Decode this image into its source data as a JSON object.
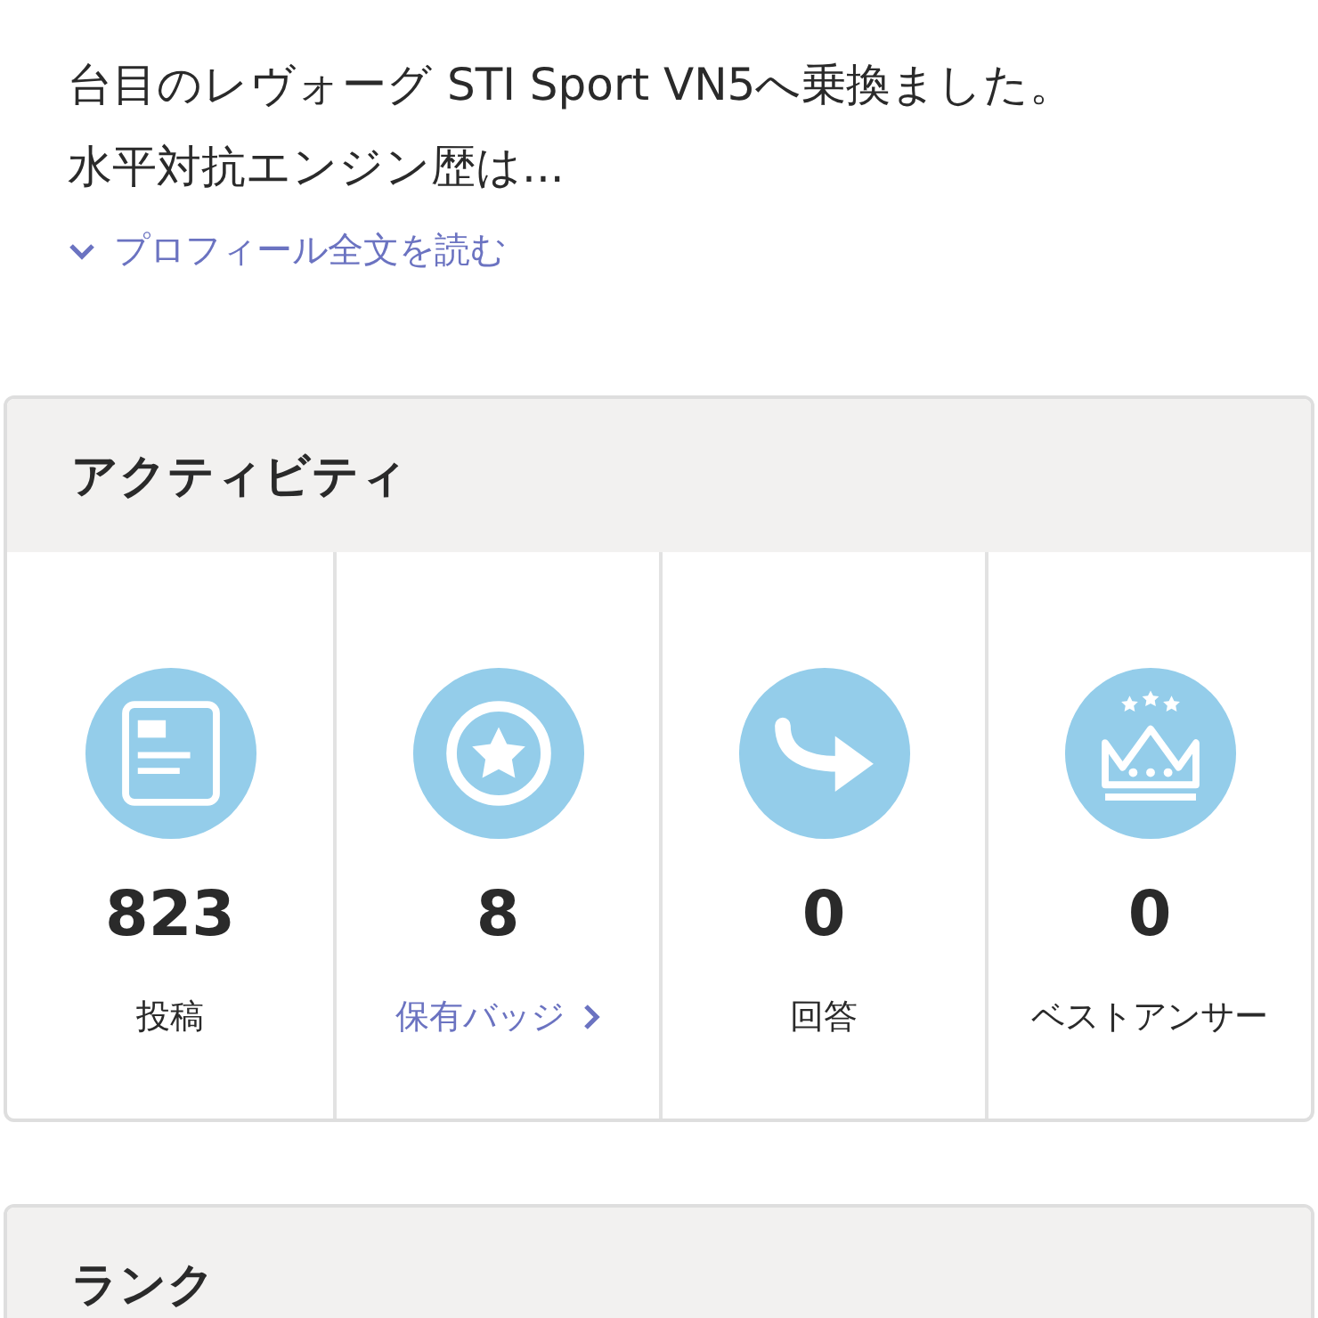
{
  "profile": {
    "lines": [
      "台目のレヴォーグ STI Sport VN5へ乗換ました。",
      "水平対抗エンジン歴は..."
    ],
    "read_more": "プロフィール全文を読む"
  },
  "activity": {
    "title": "アクティビティ",
    "stats": [
      {
        "value": "823",
        "label": "投稿",
        "kind": "plain"
      },
      {
        "value": "8",
        "label": "保有バッジ",
        "kind": "link"
      },
      {
        "value": "0",
        "label": "回答",
        "kind": "plain"
      },
      {
        "value": "0",
        "label": "ベストアンサー",
        "kind": "plain"
      }
    ]
  },
  "rank": {
    "title": "ランク"
  }
}
